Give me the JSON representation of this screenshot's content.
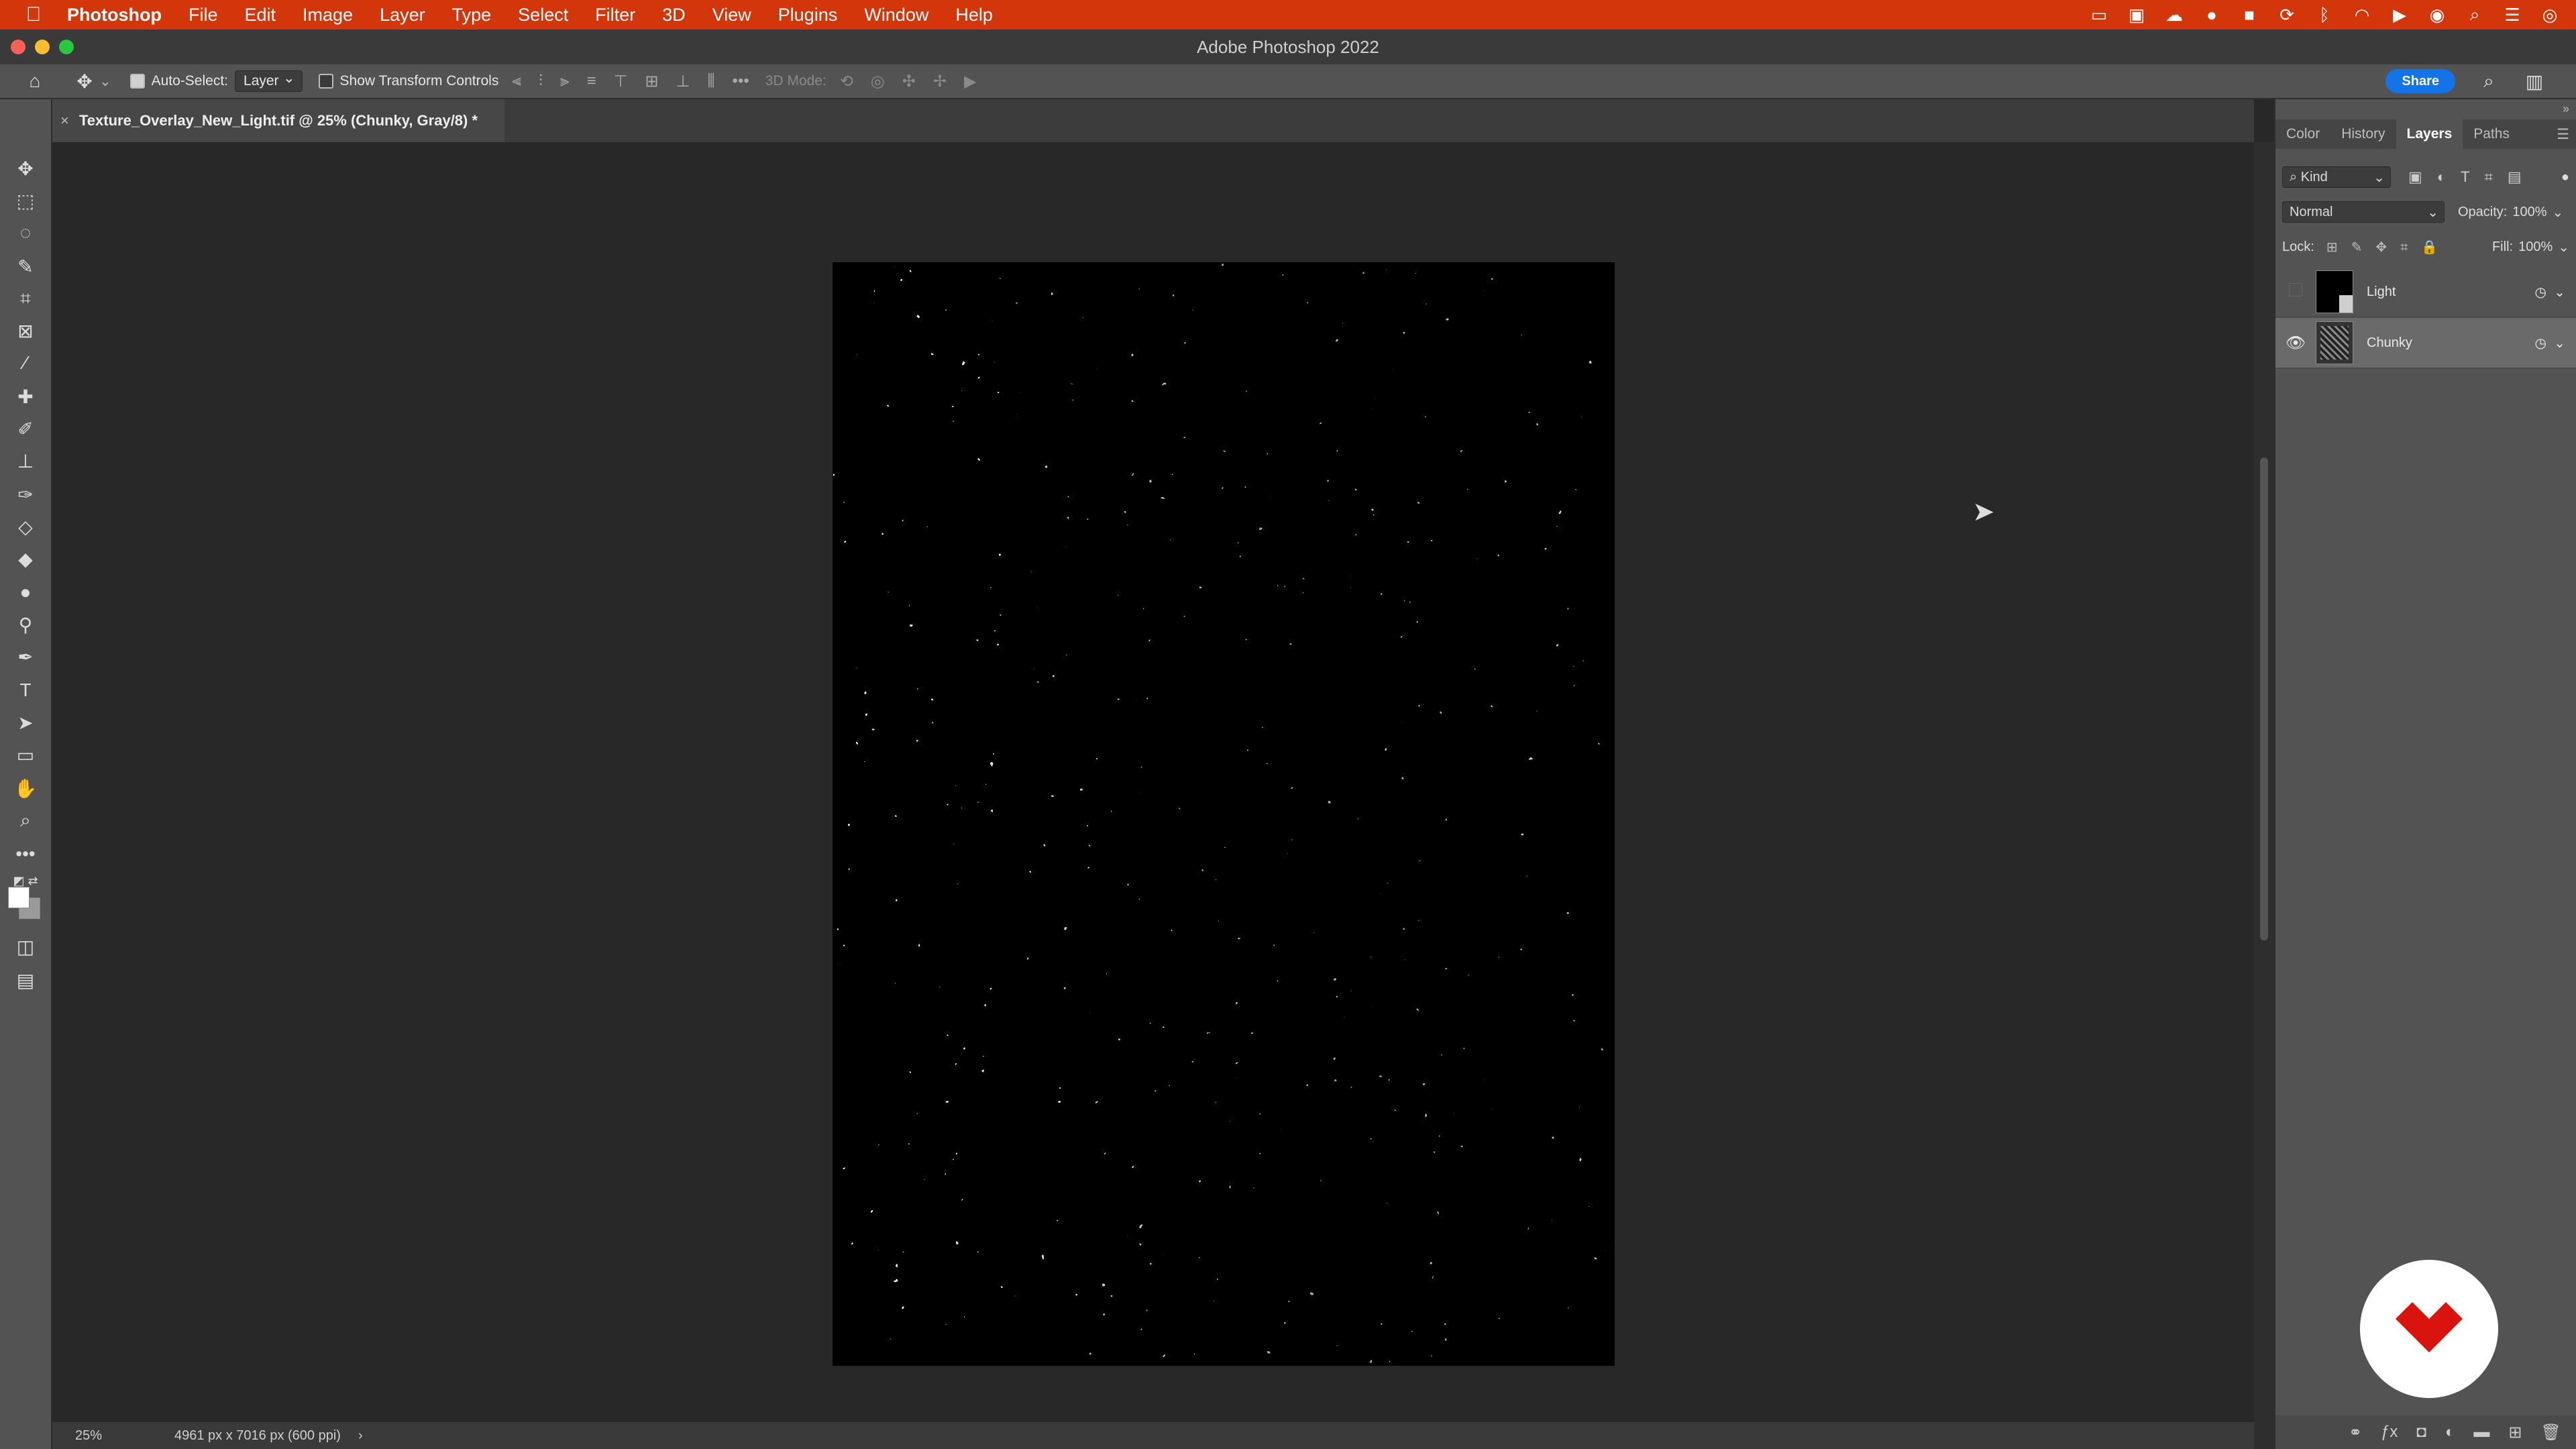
{
  "menubar": {
    "app_name": "Photoshop",
    "items": [
      "File",
      "Edit",
      "Image",
      "Layer",
      "Type",
      "Select",
      "Filter",
      "3D",
      "View",
      "Plugins",
      "Window",
      "Help"
    ]
  },
  "window": {
    "title": "Adobe Photoshop 2022"
  },
  "options_bar": {
    "auto_select_label": "Auto-Select:",
    "auto_select_value": "Layer",
    "show_transform_label": "Show Transform Controls",
    "mode_3d_label": "3D Mode:",
    "share_label": "Share"
  },
  "document": {
    "tab_title": "Texture_Overlay_New_Light.tif @ 25% (Chunky, Gray/8) *"
  },
  "status": {
    "zoom": "25%",
    "dimensions": "4961 px x 7016 px (600 ppi)"
  },
  "panels": {
    "tabs": [
      "Color",
      "History",
      "Layers",
      "Paths"
    ],
    "active_tab": "Layers",
    "filter_kind": "Kind",
    "blend_mode": "Normal",
    "opacity_label": "Opacity:",
    "opacity_value": "100%",
    "lock_label": "Lock:",
    "fill_label": "Fill:",
    "fill_value": "100%",
    "layers": [
      {
        "name": "Light",
        "visible": false,
        "selected": false
      },
      {
        "name": "Chunky",
        "visible": true,
        "selected": true
      }
    ]
  },
  "colors": {
    "menubar": "#d4360c",
    "share_button": "#1473e6",
    "logo_red": "#d9140e"
  }
}
